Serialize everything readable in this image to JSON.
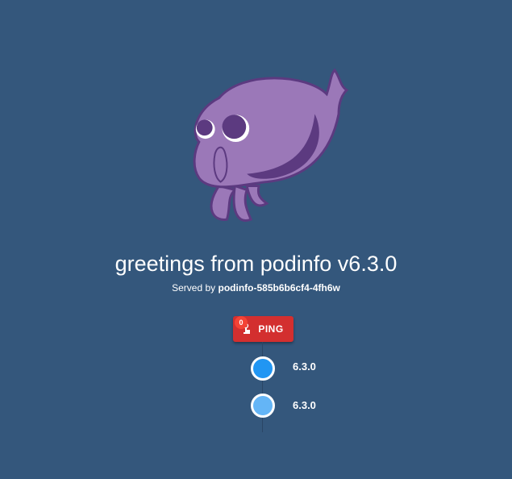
{
  "header": {
    "title": "greetings from podinfo v6.3.0",
    "served_prefix": "Served by",
    "hostname": "podinfo-585b6b6cf4-4fh6w"
  },
  "ping": {
    "label": "PING",
    "count": "0",
    "icon": "touch-icon",
    "color": "#d32f2f"
  },
  "timeline": [
    {
      "version": "6.3.0",
      "color": "#2196f3"
    },
    {
      "version": "6.3.0",
      "color": "#64b5f6"
    }
  ],
  "colors": {
    "background": "#34577c",
    "mascot": "#9b78b8",
    "mascot_dark": "#5c3a80"
  }
}
